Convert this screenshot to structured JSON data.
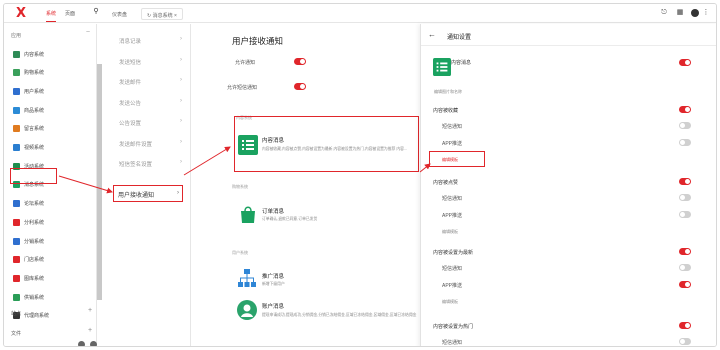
{
  "topbar": {
    "nav": [
      "系统",
      "页面"
    ],
    "tabs": [
      "仪表盘",
      "消息系统"
    ]
  },
  "sidebar": {
    "section_app": "应用",
    "items": [
      {
        "label": "内容系统",
        "color": "#2e8b57"
      },
      {
        "label": "购物系统",
        "color": "#3aa05b"
      },
      {
        "label": "用户系统",
        "color": "#2f6fcf"
      },
      {
        "label": "商品系统",
        "color": "#2b8bd6"
      },
      {
        "label": "留言系统",
        "color": "#e07b20"
      },
      {
        "label": "视频系统",
        "color": "#2a7ed0"
      },
      {
        "label": "活动系统",
        "color": "#1f8f4e"
      },
      {
        "label": "消息系统",
        "color": "#1aa260"
      },
      {
        "label": "论坛系统",
        "color": "#2f6fcf"
      },
      {
        "label": "分利系统",
        "color": "#e0262b"
      },
      {
        "label": "分销系统",
        "color": "#2f6fcf"
      },
      {
        "label": "门店系统",
        "color": "#e0262b"
      },
      {
        "label": "图库系统",
        "color": "#e0262b"
      },
      {
        "label": "供销系统",
        "color": "#2a9d57"
      },
      {
        "label": "代理商系统",
        "color": "#333333"
      }
    ],
    "section_site": "站点",
    "section_file": "文件"
  },
  "submenu": {
    "items": [
      "消息记录",
      "发送短信",
      "发送邮件",
      "发送公告",
      "公告设置",
      "发送邮件设置",
      "短信签名设置"
    ],
    "active": "用户接收通知"
  },
  "content": {
    "title": "用户接收通知",
    "allow_notify": "允许通知",
    "allow_sms": "允许短信通知",
    "sec_content": "内容系统",
    "card_content_name": "内容消息",
    "card_content_desc": "内容被收藏,内容被点赞,内容被设置为最新,内容被设置为热门,内容被设置为推荐 内容...",
    "sec_shop": "购物系统",
    "card_order_name": "订单消息",
    "card_order_desc": "订单确认,退款已同意,订单已发货",
    "sec_user": "用户系统",
    "card_promo_name": "推广消息",
    "card_promo_desc": "新增下级用户",
    "card_account_name": "账户消息",
    "card_account_desc": "提现申请成功,提现成功,分销佣金,分销已冻结佣金,区域已冻结佣金,区域佣金,区域已冻结佣金"
  },
  "panel": {
    "title": "通知设置",
    "name": "内容消息",
    "edit_link": "编辑图片和名称",
    "groups": [
      {
        "title": "内容被收藏",
        "sms": "短信通知",
        "app": "APP推送",
        "tpl": "编辑模板",
        "on": [
          false,
          false
        ]
      },
      {
        "title": "内容被点赞",
        "sms": "短信通知",
        "app": "APP推送",
        "tpl": "编辑模板",
        "on": [
          false,
          false
        ]
      },
      {
        "title": "内容被设置为最新",
        "sms": "短信通知",
        "app": "APP推送",
        "tpl": "编辑模板",
        "on": [
          false,
          true
        ]
      },
      {
        "title": "内容被设置为热门",
        "sms": "短信通知",
        "app": "",
        "tpl": "",
        "on": [
          false,
          false
        ]
      }
    ]
  }
}
